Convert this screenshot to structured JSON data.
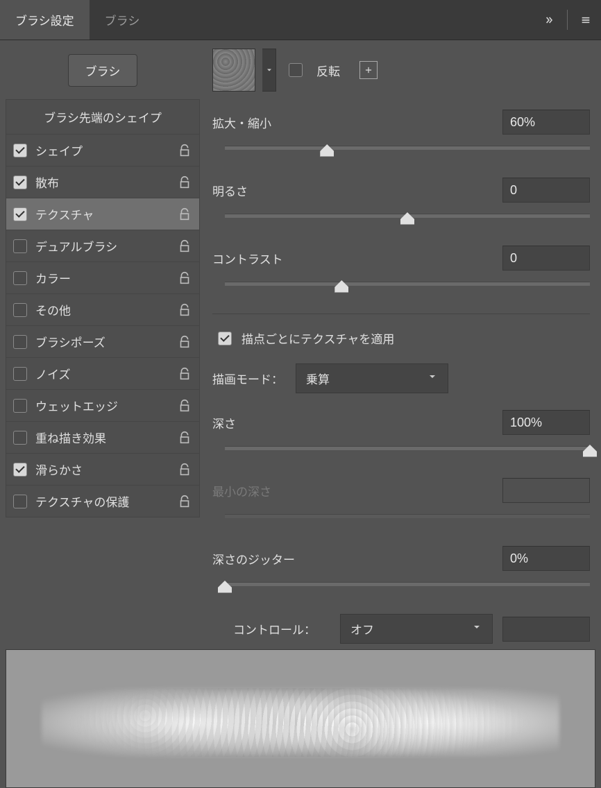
{
  "tabs": {
    "settings": "ブラシ設定",
    "brushes": "ブラシ"
  },
  "sidebar": {
    "brush_button": "ブラシ",
    "header": "ブラシ先端のシェイプ",
    "items": [
      {
        "label": "シェイプ",
        "checked": true
      },
      {
        "label": "散布",
        "checked": true
      },
      {
        "label": "テクスチャ",
        "checked": true,
        "selected": true
      },
      {
        "label": "デュアルブラシ",
        "checked": false
      },
      {
        "label": "カラー",
        "checked": false
      },
      {
        "label": "その他",
        "checked": false
      },
      {
        "label": "ブラシポーズ",
        "checked": false
      },
      {
        "label": "ノイズ",
        "checked": false
      },
      {
        "label": "ウェットエッジ",
        "checked": false
      },
      {
        "label": "重ね描き効果",
        "checked": false
      },
      {
        "label": "滑らかさ",
        "checked": true
      },
      {
        "label": "テクスチャの保護",
        "checked": false
      }
    ]
  },
  "panel": {
    "invert_label": "反転",
    "invert_checked": false,
    "scale": {
      "label": "拡大・縮小",
      "value": "60%",
      "pos": 28
    },
    "brightness": {
      "label": "明るさ",
      "value": "0",
      "pos": 50
    },
    "contrast": {
      "label": "コントラスト",
      "value": "0",
      "pos": 32
    },
    "apply_each": {
      "label": "描点ごとにテクスチャを適用",
      "checked": true
    },
    "mode": {
      "label": "描画モード：",
      "value": "乗算"
    },
    "depth": {
      "label": "深さ",
      "value": "100%",
      "pos": 100
    },
    "min_depth": {
      "label": "最小の深さ",
      "value": "",
      "disabled": true
    },
    "depth_jitter": {
      "label": "深さのジッター",
      "value": "0%",
      "pos": 0
    },
    "control": {
      "label": "コントロール：",
      "value": "オフ",
      "extra": ""
    }
  }
}
